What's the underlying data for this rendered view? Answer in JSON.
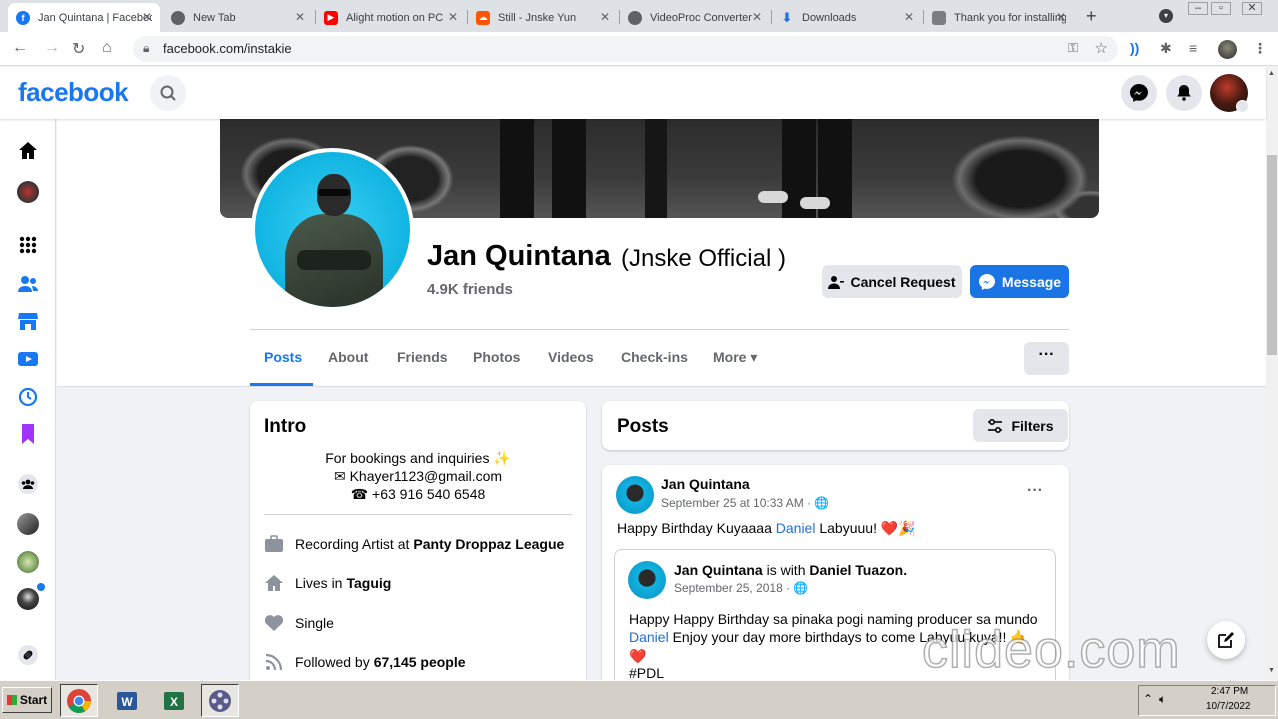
{
  "browser": {
    "tabs": [
      {
        "title": "Jan Quintana | Facebook",
        "active": true,
        "icon": "facebook-icon",
        "color": "#1877f2"
      },
      {
        "title": "New Tab",
        "icon": "chrome-icon",
        "color": "#5f6368"
      },
      {
        "title": "Alight motion on PC",
        "icon": "youtube-icon",
        "color": "#ff0000"
      },
      {
        "title": "Still - Jnske Yun",
        "icon": "soundcloud-icon",
        "color": "#ff5500"
      },
      {
        "title": "VideoProc Converter",
        "icon": "globe-icon",
        "color": "#5f6368"
      },
      {
        "title": "Downloads",
        "icon": "download-icon",
        "color": "#1a73e8"
      },
      {
        "title": "Thank you for installing",
        "icon": "extension-icon",
        "color": "#5f6368"
      }
    ],
    "url": "facebook.com/instakie"
  },
  "fb": {
    "logo": "facebook",
    "brand_color": "#1877f2"
  },
  "profile": {
    "name": "Jan Quintana",
    "alternate_name": "(Jnske Official )",
    "friends": "4.9K friends",
    "cancel_label": "Cancel Request",
    "message_label": "Message",
    "more_label": "···"
  },
  "tabs": [
    {
      "label": "Posts",
      "active": true
    },
    {
      "label": "About"
    },
    {
      "label": "Friends"
    },
    {
      "label": "Photos"
    },
    {
      "label": "Videos"
    },
    {
      "label": "Check-ins"
    },
    {
      "label": "More ▾"
    }
  ],
  "intro": {
    "title": "Intro",
    "bio": [
      "For bookings and inquiries ✨",
      "✉ Khayer1123@gmail.com",
      "☎ +63 916 540 6548"
    ],
    "work": {
      "prefix": "Recording Artist at",
      "value": "Panty Droppaz League"
    },
    "lives": {
      "prefix": "Lives in",
      "value": "Taguig"
    },
    "relationship": "Single",
    "followers": {
      "prefix": "Followed by",
      "value": "67,145 people"
    }
  },
  "posts": {
    "title": "Posts",
    "filters_label": "Filters",
    "post": {
      "author": "Jan Quintana",
      "time": "September 25 at 10:33 AM · 🌐",
      "text_before": "Happy Birthday Kuyaaaa",
      "mention": "Daniel",
      "text_after": "Labyuuu! ❤️🎉",
      "shared": {
        "author": "Jan Quintana",
        "with_label": "is with",
        "with_name": "Daniel Tuazon.",
        "time": "September 25, 2018 · 🌐",
        "line1": "Happy Happy Birthday sa pinaka pogi naming producer sa mundo",
        "line2_mention": "Daniel",
        "line2_text": "Enjoy your day more birthdays to come Labyuu kuya!! 🤙",
        "line3": "❤️",
        "hashtag": "#PDL"
      }
    }
  },
  "watermark": "clideo.com",
  "taskbar": {
    "start": "Start",
    "time": "2:47 PM",
    "date": "10/7/2022"
  }
}
